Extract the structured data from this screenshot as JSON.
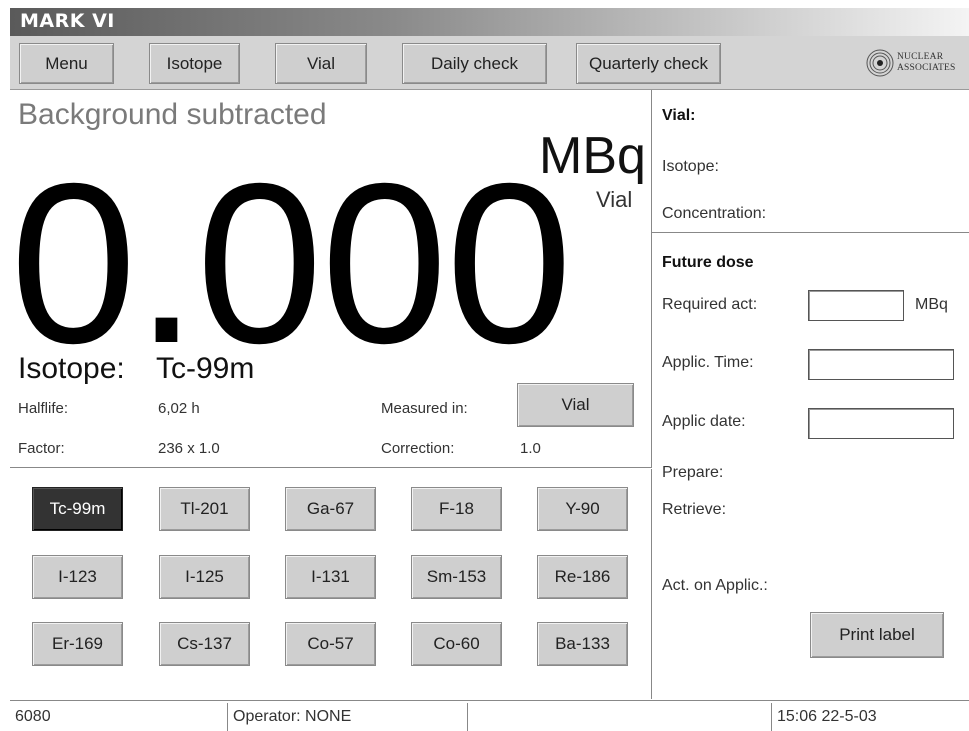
{
  "window": {
    "title": "MARK VI"
  },
  "toolbar": {
    "buttons": [
      {
        "label": "Menu"
      },
      {
        "label": "Isotope"
      },
      {
        "label": "Vial"
      },
      {
        "label": "Daily check"
      },
      {
        "label": "Quarterly check"
      }
    ],
    "logo": {
      "line1": "NUCLEAR",
      "line2": "ASSOCIATES"
    }
  },
  "measurement": {
    "mode_label": "Background subtracted",
    "unit": "MBq",
    "unit_sub": "Vial",
    "value": "0.000",
    "isotope_label": "Isotope:",
    "isotope_value": "Tc-99m",
    "halflife_label": "Halflife:",
    "halflife_value": "6,02 h",
    "factor_label": "Factor:",
    "factor_value": "236 x 1.0",
    "measured_in_label": "Measured in:",
    "measured_in_button": "Vial",
    "correction_label": "Correction:",
    "correction_value": "1.0"
  },
  "isotopes": {
    "selected": "Tc-99m",
    "buttons": [
      "Tc-99m",
      "Tl-201",
      "Ga-67",
      "F-18",
      "Y-90",
      "I-123",
      "I-125",
      "I-131",
      "Sm-153",
      "Re-186",
      "Er-169",
      "Cs-137",
      "Co-57",
      "Co-60",
      "Ba-133"
    ]
  },
  "vial_info": {
    "vial_label": "Vial:",
    "isotope_label": "Isotope:",
    "concentration_label": "Concentration:"
  },
  "future_dose": {
    "heading": "Future dose",
    "required_act_label": "Required act:",
    "required_act_value": "",
    "required_act_unit": "MBq",
    "applic_time_label": "Applic. Time:",
    "applic_time_value": "",
    "applic_date_label": "Applic date:",
    "applic_date_value": "",
    "prepare_label": "Prepare:",
    "retrieve_label": "Retrieve:",
    "act_on_applic_label": "Act. on Applic.:",
    "print_button": "Print label"
  },
  "statusbar": {
    "cells": [
      "6080",
      "Operator: NONE",
      "",
      "15:06 22-5-03"
    ]
  }
}
